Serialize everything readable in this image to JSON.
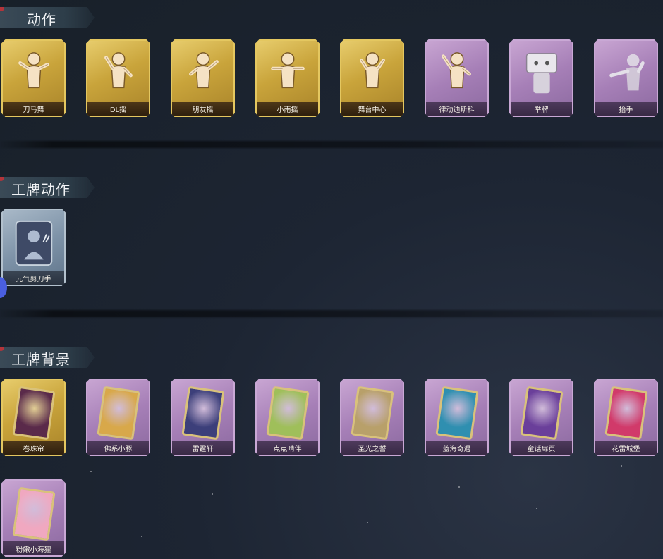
{
  "sections": [
    {
      "title": "动作",
      "items": [
        {
          "label": "刀马舞",
          "rarity": "gold",
          "icon": "dance-pose-icon"
        },
        {
          "label": "DL摇",
          "rarity": "gold",
          "icon": "music-dance-icon"
        },
        {
          "label": "朋友摇",
          "rarity": "gold",
          "icon": "wave-pose-icon"
        },
        {
          "label": "小雨摇",
          "rarity": "gold",
          "icon": "sway-pose-icon"
        },
        {
          "label": "舞台中心",
          "rarity": "gold",
          "icon": "spotlight-pose-icon"
        },
        {
          "label": "律动迪斯科",
          "rarity": "purple",
          "icon": "disco-pose-icon"
        },
        {
          "label": "举牌",
          "rarity": "purple",
          "icon": "hold-sign-icon"
        },
        {
          "label": "抬手",
          "rarity": "purple",
          "icon": "raise-hand-icon"
        }
      ]
    },
    {
      "title": "工牌动作",
      "items": [
        {
          "label": "元气剪刀手",
          "rarity": "blue",
          "icon": "peace-sign-card-icon"
        }
      ]
    },
    {
      "title": "工牌背景",
      "items": [
        {
          "label": "卷珠帘",
          "rarity": "gold",
          "poster_color": "#5a2a4a"
        },
        {
          "label": "佛系小豚",
          "rarity": "purple",
          "poster_color": "#d8a84a"
        },
        {
          "label": "雷霆轩",
          "rarity": "purple",
          "poster_color": "#3c3f7a"
        },
        {
          "label": "点点晴伴",
          "rarity": "purple",
          "poster_color": "#9fbf5a"
        },
        {
          "label": "圣光之誓",
          "rarity": "purple",
          "poster_color": "#b8a06a"
        },
        {
          "label": "蓝海奇遇",
          "rarity": "purple",
          "poster_color": "#2f8fb0"
        },
        {
          "label": "童话扉页",
          "rarity": "purple",
          "poster_color": "#6a3f9a"
        },
        {
          "label": "花雷城堡",
          "rarity": "purple",
          "poster_color": "#d13a6a"
        },
        {
          "label": "粉嫩小海狸",
          "rarity": "purple",
          "poster_color": "#f0a8c0"
        }
      ]
    }
  ],
  "colors": {
    "gold": "#c9a43b",
    "purple": "#a67fb7",
    "blue": "#7e93a8",
    "background": "#1d2533"
  }
}
